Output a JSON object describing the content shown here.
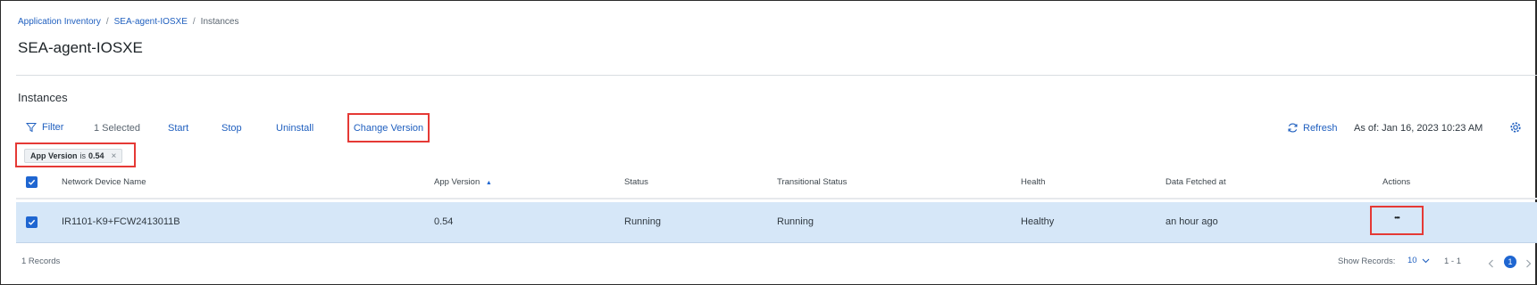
{
  "breadcrumb": {
    "items": [
      "Application Inventory",
      "SEA-agent-IOSXE",
      "Instances"
    ],
    "separator": "/"
  },
  "page": {
    "title": "SEA-agent-IOSXE",
    "section_title": "Instances"
  },
  "toolbar": {
    "filter_label": "Filter",
    "selected_label": "1 Selected",
    "start_label": "Start",
    "stop_label": "Stop",
    "uninstall_label": "Uninstall",
    "change_version_label": "Change Version",
    "refresh_label": "Refresh",
    "as_of_label": "As of: Jan 16, 2023 10:23 AM"
  },
  "filter_chip": {
    "field": "App Version",
    "operator": "is",
    "value": "0.54",
    "close": "×"
  },
  "table": {
    "columns": [
      "Network Device Name",
      "App Version",
      "Status",
      "Transitional Status",
      "Health",
      "Data Fetched at",
      "Actions"
    ],
    "sort_indicator": "▲",
    "rows": [
      {
        "device_name": "IR1101-K9+FCW2413011B",
        "app_version": "0.54",
        "status": "Running",
        "transitional_status": "Running",
        "health": "Healthy",
        "fetched": "an hour ago",
        "actions": "•••",
        "selected": true
      }
    ]
  },
  "footer": {
    "records": "1 Records",
    "show_records_label": "Show Records:",
    "page_size": "10",
    "range": "1 - 1",
    "current_page": "1"
  },
  "colors": {
    "accent": "#1f66d1",
    "link": "#1f5fbf",
    "selected_row": "#d6e7f8",
    "highlight": "#e53935"
  }
}
